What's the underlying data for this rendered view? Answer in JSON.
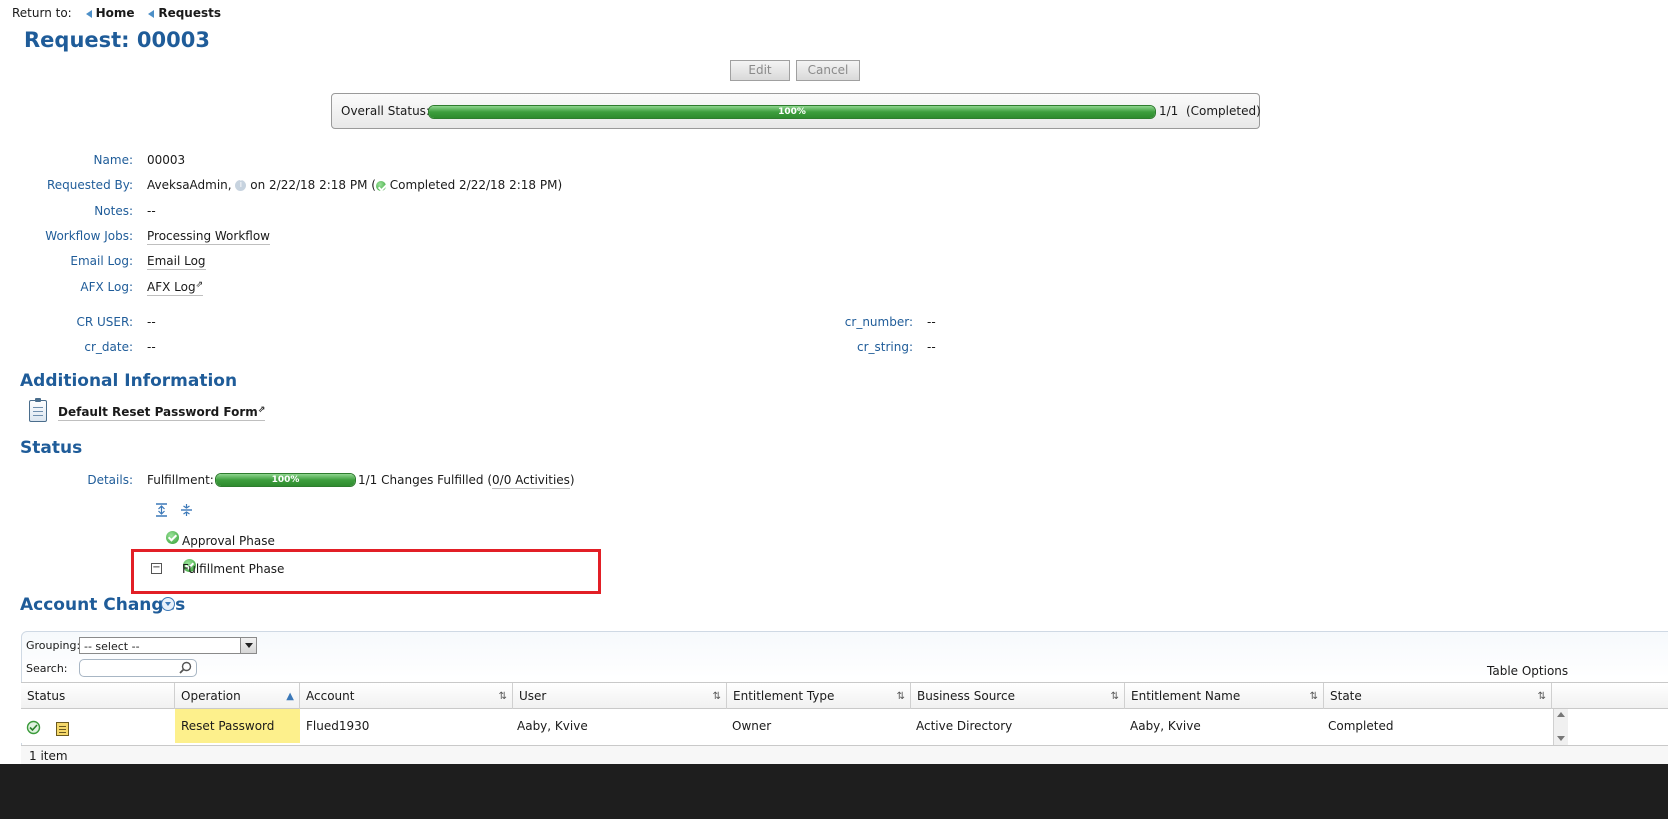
{
  "nav": {
    "return_label": "Return to:",
    "home": "Home",
    "requests": "Requests"
  },
  "page_title": "Request: 00003",
  "toolbar": {
    "edit": "Edit",
    "cancel": "Cancel"
  },
  "overall_status": {
    "label": "Overall Status:",
    "percent_text": "100%",
    "progress": 1.0,
    "summary": "1/1  (Completed)"
  },
  "fields": {
    "name_label": "Name:",
    "name_value": "00003",
    "requested_by_label": "Requested By:",
    "requested_by_user": "AveksaAdmin,",
    "requested_by_on": "on 2/22/18 2:18 PM (",
    "requested_by_completed": "Completed 2/22/18 2:18 PM)",
    "notes_label": "Notes:",
    "notes_value": "--",
    "workflow_label": "Workflow Jobs:",
    "workflow_value": "Processing Workflow",
    "email_label": "Email Log:",
    "email_value": "Email Log",
    "afx_label": "AFX Log:",
    "afx_value": "AFX Log",
    "cr_user_label": "CR USER:",
    "cr_user_value": "--",
    "cr_date_label": "cr_date:",
    "cr_date_value": "--",
    "cr_number_label": "cr_number:",
    "cr_number_value": "--",
    "cr_string_label": "cr_string:",
    "cr_string_value": "--"
  },
  "additional_info": {
    "heading": "Additional Information",
    "form_link": "Default Reset Password Form"
  },
  "status_section": {
    "heading": "Status",
    "details_label": "Details:",
    "fulfillment_label": "Fulfillment:",
    "percent_text": "100%",
    "progress": 1.0,
    "changes_text": "1/1 Changes Fulfilled (",
    "activities_link": "0/0 Activities",
    "close_paren": ")",
    "phases": [
      "Approval Phase",
      "Fulfillment Phase"
    ],
    "highlight_color": "#e21f26"
  },
  "account_changes": {
    "heading": "Account Changes",
    "grouping_label": "Grouping:",
    "grouping_value": "-- select --",
    "search_label": "Search:",
    "search_value": "",
    "table_options": "Table Options",
    "columns": [
      "Status",
      "Operation",
      "Account",
      "User",
      "Entitlement Type",
      "Business Source",
      "Entitlement Name",
      "State"
    ],
    "rows": [
      {
        "operation": "Reset Password",
        "account": "Flued1930",
        "user": "Aaby, Kvive",
        "entitlement_type": "Owner",
        "business_source": "Active Directory",
        "entitlement_name": "Aaby, Kvive",
        "state": "Completed"
      }
    ],
    "footer": "1 item",
    "operation_highlight_color": "#fdf08c"
  }
}
